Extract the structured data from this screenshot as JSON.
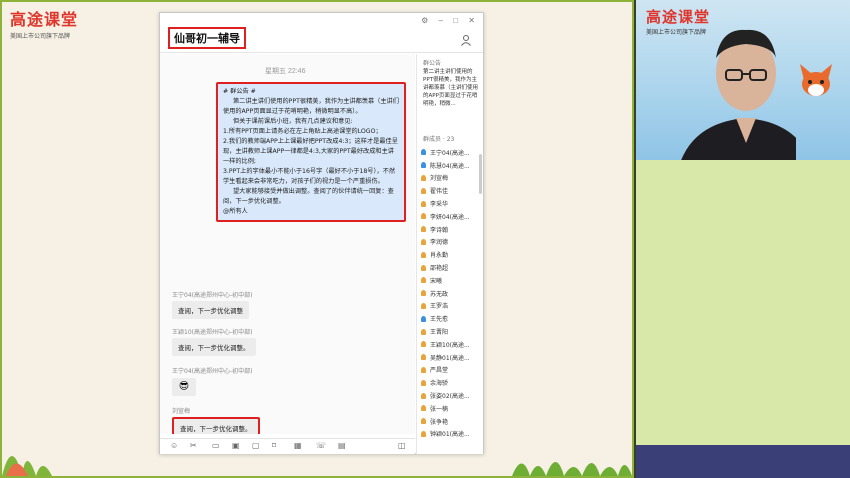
{
  "slide_brand": {
    "title": "高途课堂",
    "subtitle": "美国上市公司旗下品牌"
  },
  "cam_brand": {
    "title": "高途课堂",
    "subtitle": "美国上市公司旗下品牌"
  },
  "window": {
    "title": "仙哥初一辅导",
    "controls": {
      "settings": "⚙",
      "minimize": "–",
      "maximize": "□",
      "close": "✕"
    },
    "timestamp": "星期五 22:46",
    "notice": {
      "head": "# 群公告 #",
      "lines": [
        "第二讲主讲们使用的PPT很精美，我作为主讲都羡慕（主讲们使用的APP页面显过于花哨明艳，稍微明显不高）。",
        "但关于课前课后小班，我有几点建议和意见:",
        "1.所有PPT页面上请务必在左上角贴上高途课堂的LOGO；",
        "2.我们的教师端APP上上课最好把PPT改成4:3；这样才是最佳呈现，主讲教师上课APP一律都是4:3,大家的PPT最好改成和主讲一样的比例;",
        "3.PPT上的字体最小不能小于16号字（最好不小于18号），不然学生看起来会非常吃力，对孩子们的视力是一个严重损伤。",
        "望大家能够接受并做出调整。查阅了的伙伴请统一回复：查阅，下一步优化调整。",
        "@所有人"
      ]
    },
    "messages": [
      {
        "sender": "王宁04(高途郑州中心-初中部)",
        "text": "查阅，下一步优化调整"
      },
      {
        "sender": "王颖10(高途郑州中心-初中部)",
        "text": "查阅，下一步优化调整。"
      },
      {
        "sender": "王宁04(高途郑州中心-初中部)",
        "text": "😎"
      },
      {
        "sender": "刘宣梅",
        "text": "查阅，下一步优化调整。"
      }
    ],
    "toolbar_icons": [
      "smile-icon",
      "scissors-icon",
      "folder-icon",
      "image-icon",
      "screen-icon",
      "file-icon",
      "grid-icon",
      "phone-icon",
      "chat-icon",
      "history-icon"
    ]
  },
  "side_panel": {
    "notice_label": "群公告",
    "notice_text": "第二讲主讲们使用的PPT很精美，我作为主讲都羡慕（主讲们使用的APP页面显过于花哨明艳，稍微...",
    "members_label": "群成员 · 23",
    "members": [
      {
        "name": "王宁04(高途...",
        "color": "#3d8fe0"
      },
      {
        "name": "陈慧04(高途...",
        "color": "#3d8fe0"
      },
      {
        "name": "刘宣梅",
        "color": "#e8a33a"
      },
      {
        "name": "翟伟佳",
        "color": "#e8a33a"
      },
      {
        "name": "李采华",
        "color": "#e8a33a"
      },
      {
        "name": "李妍04(高途...",
        "color": "#e8a33a"
      },
      {
        "name": "李诗翰",
        "color": "#e8a33a"
      },
      {
        "name": "李润德",
        "color": "#e8a33a"
      },
      {
        "name": "肖永勤",
        "color": "#e8a33a"
      },
      {
        "name": "邵艳超",
        "color": "#e8a33a"
      },
      {
        "name": "宋曦",
        "color": "#e8a33a"
      },
      {
        "name": "苏无政",
        "color": "#e8a33a"
      },
      {
        "name": "王罗浩",
        "color": "#e8a33a"
      },
      {
        "name": "王先愈",
        "color": "#3d8fe0"
      },
      {
        "name": "王晋阳",
        "color": "#e8a33a"
      },
      {
        "name": "王颖10(高途...",
        "color": "#e8a33a"
      },
      {
        "name": "吴静01(高途...",
        "color": "#e8a33a"
      },
      {
        "name": "严昌堂",
        "color": "#e8a33a"
      },
      {
        "name": "余海骄",
        "color": "#e8a33a"
      },
      {
        "name": "张姿02(高途...",
        "color": "#e8a33a"
      },
      {
        "name": "张一楠",
        "color": "#e8a33a"
      },
      {
        "name": "张争艳",
        "color": "#e8a33a"
      },
      {
        "name": "钟颖01(高途...",
        "color": "#e8a33a"
      }
    ]
  }
}
